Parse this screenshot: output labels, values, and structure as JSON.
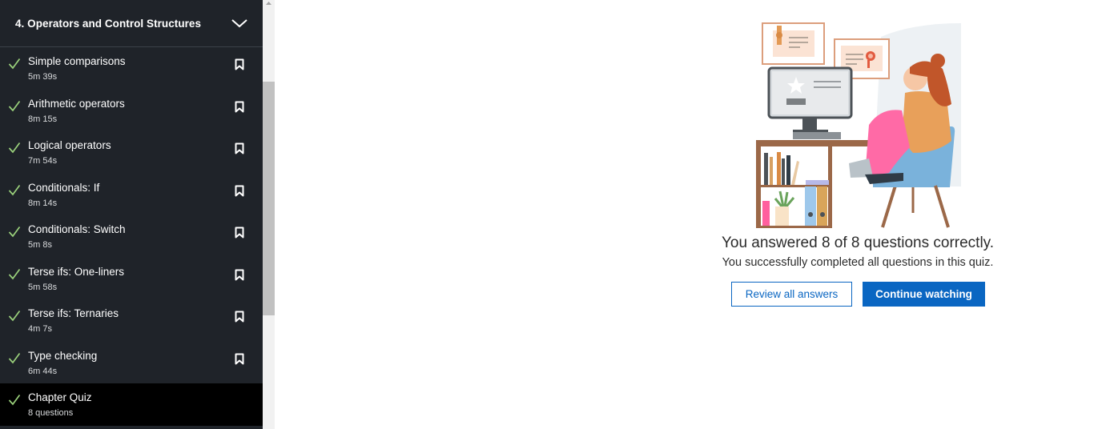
{
  "sidebar": {
    "chapter_title": "4. Operators and Control Structures",
    "items": [
      {
        "title": "Simple comparisons",
        "duration": "5m 39s",
        "completed": true,
        "bookmark": true
      },
      {
        "title": "Arithmetic operators",
        "duration": "8m 15s",
        "completed": true,
        "bookmark": true
      },
      {
        "title": "Logical operators",
        "duration": "7m 54s",
        "completed": true,
        "bookmark": true
      },
      {
        "title": "Conditionals: If",
        "duration": "8m 14s",
        "completed": true,
        "bookmark": true
      },
      {
        "title": "Conditionals: Switch",
        "duration": "5m 8s",
        "completed": true,
        "bookmark": true
      },
      {
        "title": "Terse ifs: One-liners",
        "duration": "5m 58s",
        "completed": true,
        "bookmark": true
      },
      {
        "title": "Terse ifs: Ternaries",
        "duration": "4m 7s",
        "completed": true,
        "bookmark": true
      },
      {
        "title": "Type checking",
        "duration": "6m 44s",
        "completed": true,
        "bookmark": true
      },
      {
        "title": "Chapter Quiz",
        "duration": "8 questions",
        "completed": true,
        "bookmark": false,
        "active": true
      }
    ]
  },
  "quiz_result": {
    "headline": "You answered 8 of 8 questions correctly.",
    "subline": "You successfully completed all questions in this quiz."
  },
  "buttons": {
    "review_label": "Review all answers",
    "continue_label": "Continue watching"
  },
  "icons": {
    "check": "check-icon",
    "bookmark": "bookmark-icon",
    "chevron": "chevron-down-icon"
  },
  "colors": {
    "sidebar_bg": "#1f2329",
    "active_bg": "#000000",
    "check": "#9bd27c",
    "primary": "#0a66c2"
  }
}
